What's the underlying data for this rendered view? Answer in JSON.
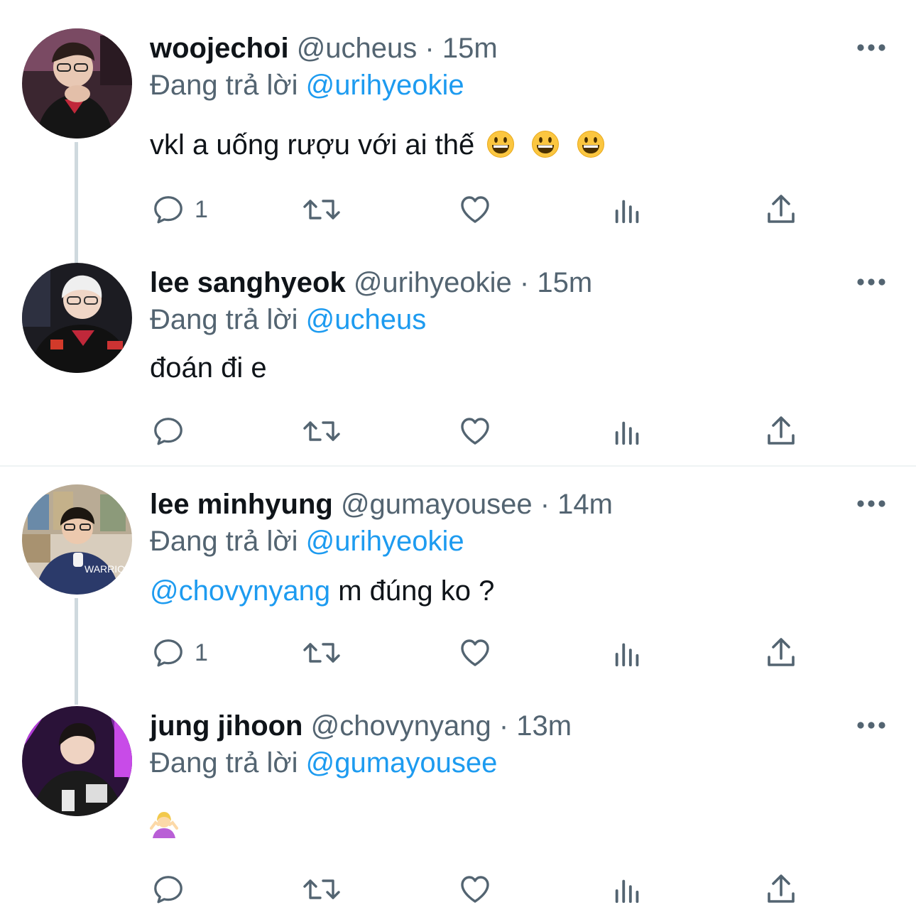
{
  "tweets": [
    {
      "name": "woojechoi",
      "handle": "@ucheus",
      "separator": "·",
      "time": "15m",
      "reply_prefix": "Đang trả lời",
      "reply_to": "@urihyeokie",
      "text": "vkl a uống rượu với ai thế",
      "text_emoji": [
        "grinning-face-emoji",
        "grinning-face-emoji",
        "grinning-face-emoji"
      ],
      "reply_count": "1"
    },
    {
      "name": "lee sanghyeok",
      "handle": "@urihyeokie",
      "separator": "·",
      "time": "15m",
      "reply_prefix": "Đang trả lời",
      "reply_to": "@ucheus",
      "text": "đoán đi e",
      "reply_count": ""
    },
    {
      "name": "lee minhyung",
      "handle": "@gumayousee",
      "separator": "·",
      "time": "14m",
      "reply_prefix": "Đang trả lời",
      "reply_to": "@urihyeokie",
      "text_mention": "@chovynyang",
      "text": " m đúng ko ?",
      "reply_count": "1"
    },
    {
      "name": "jung jihoon",
      "handle": "@chovynyang",
      "separator": "·",
      "time": "13m",
      "reply_prefix": "Đang trả lời",
      "reply_to": "@gumayousee",
      "text_emoji": [
        "person-shrugging-emoji"
      ],
      "reply_count": ""
    }
  ],
  "colors": {
    "text": "#0f1419",
    "secondary": "#536471",
    "link": "#1d9bf0",
    "thread_line": "#cfd9de",
    "divider": "#eff3f4"
  },
  "icons": [
    "reply-icon",
    "retweet-icon",
    "like-icon",
    "views-icon",
    "share-icon",
    "more-icon"
  ]
}
